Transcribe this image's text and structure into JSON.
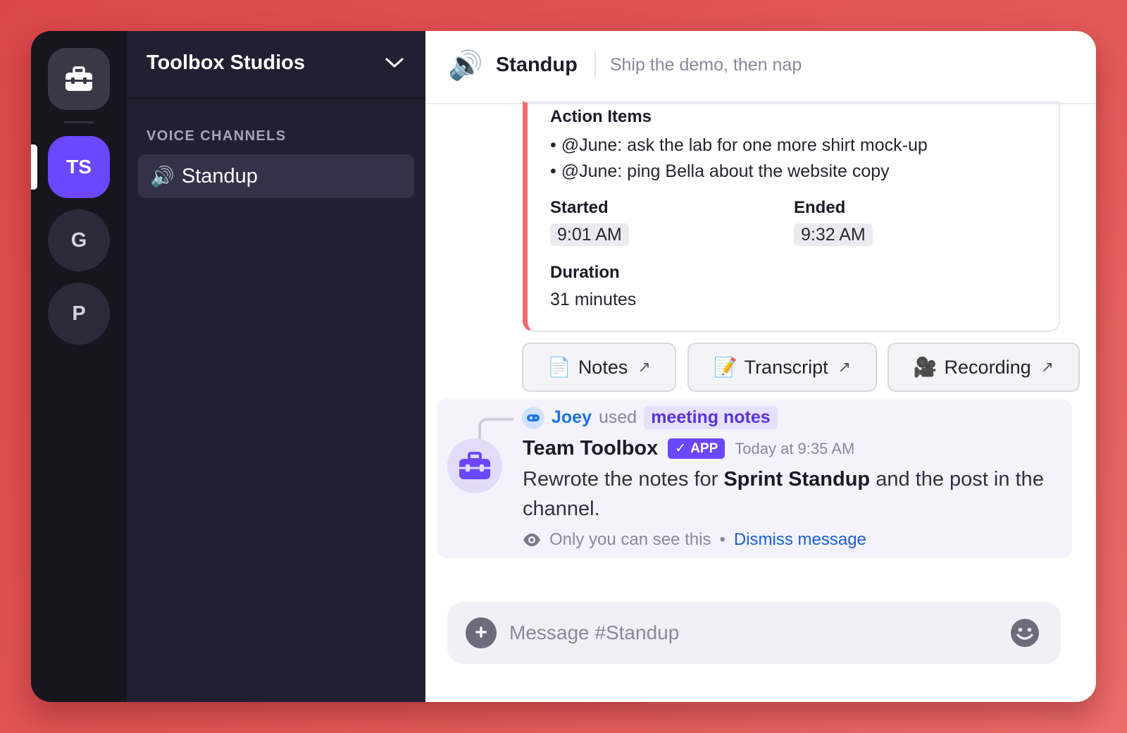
{
  "rail": {
    "home_icon": "toolbox-icon",
    "servers": [
      {
        "label": "TS",
        "active": true
      },
      {
        "label": "G",
        "active": false
      },
      {
        "label": "P",
        "active": false
      }
    ]
  },
  "sidebar": {
    "workspace_name": "Toolbox Studios",
    "section_label": "VOICE CHANNELS",
    "channels": [
      {
        "emoji": "🔊",
        "name": "Standup",
        "active": true
      }
    ]
  },
  "header": {
    "emoji": "🔊",
    "channel_name": "Standup",
    "topic": "Ship the demo, then nap"
  },
  "embed": {
    "accent_color": "#f26d6b",
    "section_title": "Action Items",
    "action_items": [
      "• @June: ask the lab for one more shirt mock-up",
      "• @June: ping Bella about the website copy"
    ],
    "started_label": "Started",
    "started_value": "9:01 AM",
    "ended_label": "Ended",
    "ended_value": "9:32 AM",
    "duration_label": "Duration",
    "duration_value": "31 minutes"
  },
  "link_buttons": [
    {
      "emoji": "📄",
      "label": "Notes",
      "arrow": "↗"
    },
    {
      "emoji": "📝",
      "label": "Transcript",
      "arrow": "↗"
    },
    {
      "emoji": "🎥",
      "label": "Recording",
      "arrow": "↗"
    }
  ],
  "interaction": {
    "user": "Joey",
    "used_text": "used",
    "command": "meeting notes"
  },
  "message": {
    "author": "Team Toolbox",
    "badge": "APP",
    "badge_check": "✓",
    "timestamp": "Today at 9:35 AM",
    "text_before": "Rewrote the notes for ",
    "text_bold": "Sprint Standup",
    "text_after": " and the post in the channel.",
    "ephemeral_note": "Only you can see this",
    "separator": "•",
    "dismiss_label": "Dismiss message"
  },
  "composer": {
    "placeholder": "Message #Standup"
  },
  "colors": {
    "brand": "#6c47ff",
    "link": "#1a5fd6",
    "background": "#e2595a"
  }
}
